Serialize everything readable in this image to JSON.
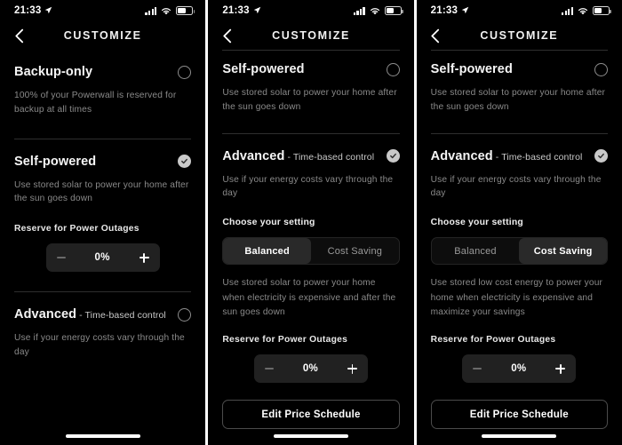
{
  "status_bar": {
    "time": "21:33",
    "location_icon": "location-arrow-icon",
    "signal_icon": "cellular-signal-icon",
    "wifi_icon": "wifi-icon",
    "battery_icon": "battery-icon"
  },
  "header": {
    "title": "CUSTOMIZE",
    "back_icon": "chevron-left-icon"
  },
  "modes": {
    "backup_only": {
      "title": "Backup-only",
      "description": "100% of your Powerwall is reserved for backup at all times",
      "selected": false
    },
    "self_powered": {
      "title": "Self-powered",
      "description": "Use stored solar to power your home after the sun goes down",
      "selected_panel1": true,
      "selected_panel2": false
    },
    "advanced": {
      "title": "Advanced",
      "subtitle": " - Time-based control",
      "description": "Use if your energy costs vary through the day",
      "selected_panel1": false,
      "selected_panel2": true
    }
  },
  "reserve": {
    "label": "Reserve for Power Outages",
    "value": "0%",
    "minus_icon": "minus-icon",
    "plus_icon": "plus-icon"
  },
  "setting_chooser": {
    "label": "Choose your setting",
    "options": [
      "Balanced",
      "Cost Saving"
    ],
    "balanced_label": "Balanced",
    "cost_saving_label": "Cost Saving",
    "balanced_description": "Use stored solar to power your home when electricity is expensive and after the sun goes down",
    "cost_saving_description": "Use stored low cost energy to power your home when electricity is expensive and maximize your savings"
  },
  "edit_price_schedule": {
    "label": "Edit Price Schedule"
  },
  "colors": {
    "background": "#000000",
    "text_primary": "#f5f5f5",
    "text_secondary": "#8a8a8a",
    "selected_fill": "#c9c9c9",
    "segment_active": "#292929",
    "stepper_bg": "#212121"
  }
}
